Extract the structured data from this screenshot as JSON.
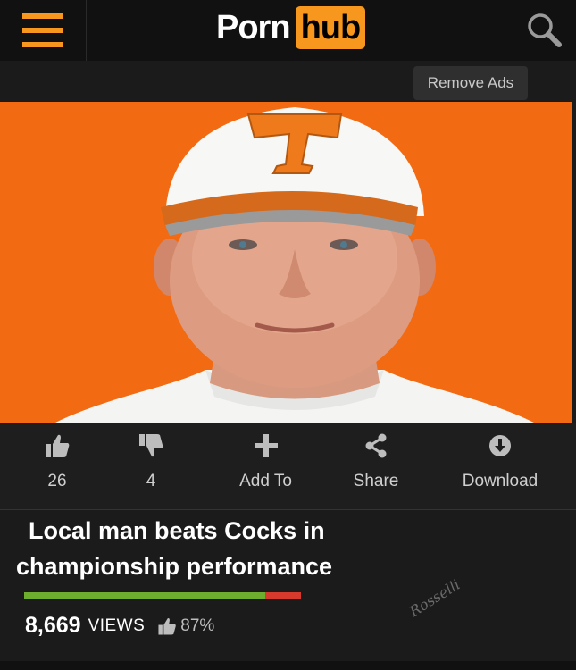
{
  "header": {
    "logo_part1": "Porn",
    "logo_part2": "hub",
    "brand_color": "#f7971d",
    "remove_ads_label": "Remove Ads"
  },
  "actions": [
    {
      "icon": "thumbs-up-icon",
      "label": "26"
    },
    {
      "icon": "thumbs-down-icon",
      "label": "4"
    },
    {
      "icon": "plus-icon",
      "label": "Add To"
    },
    {
      "icon": "share-icon",
      "label": "Share"
    },
    {
      "icon": "download-icon",
      "label": "Download"
    }
  ],
  "video": {
    "title_line1": "Local man beats Cocks in",
    "title_line2": "championship performance",
    "views_count": "8,669",
    "views_label": "VIEWS",
    "rating_percent": "87%",
    "rating_fraction": 0.87,
    "rating_colors": {
      "positive": "#6dae2f",
      "negative": "#d63a2c"
    }
  },
  "watermark": "Rosselli"
}
